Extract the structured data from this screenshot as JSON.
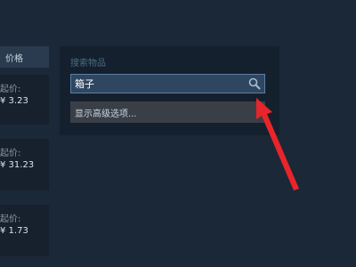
{
  "left_column": {
    "price_header": "价格",
    "items": [
      {
        "label": "起价:",
        "price": "¥ 3.23"
      },
      {
        "label": "起价:",
        "price": "¥ 31.23"
      },
      {
        "label": "起价:",
        "price": "¥ 1.73"
      }
    ]
  },
  "search_panel": {
    "label": "搜索物品",
    "query": "箱子",
    "advanced_options": "显示高级选项..."
  },
  "colors": {
    "background": "#1b2838",
    "panel": "#14202d",
    "search_box": "#2f4660",
    "annotation_arrow": "#e8252a"
  },
  "icons": {
    "search": "search-icon"
  }
}
